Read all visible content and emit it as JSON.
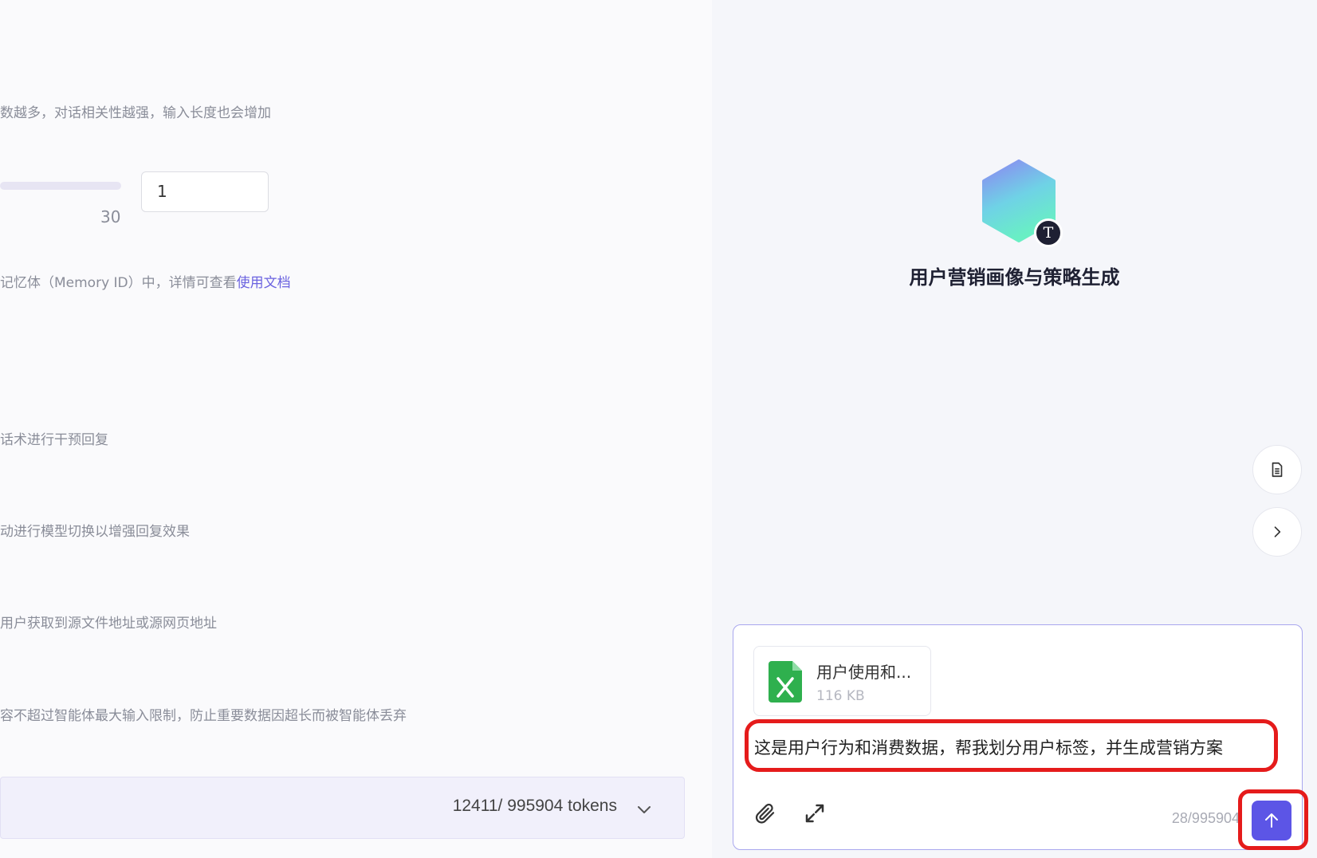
{
  "settings": {
    "rounds_desc": "数越多，对话相关性越强，输入长度也会增加",
    "slider_max": "30",
    "rounds_value": "1",
    "memory_desc_prefix": "记忆体（Memory ID）中，详情可查看",
    "memory_link": "使用文档",
    "intervene_desc": "话术进行干预回复",
    "model_switch_desc": "动进行模型切换以增强回复效果",
    "source_desc": "用户获取到源文件地址或源网页地址",
    "limit_desc": "容不超过智能体最大输入限制，防止重要数据因超长而被智能体丢弃",
    "token_usage": "12411/ 995904 tokens"
  },
  "preview": {
    "agent_badge": "T",
    "agent_title": "用户营销画像与策略生成"
  },
  "composer": {
    "file_name": "用户使用和...",
    "file_size": "116 KB",
    "message": "这是用户行为和消费数据，帮我划分用户标签，并生成营销方案",
    "counter": "28/995904"
  },
  "colors": {
    "accent": "#5c55e6",
    "highlight": "#e51b1b",
    "link": "#6b63e0",
    "excel": "#2fb04e"
  },
  "icons": [
    "chevron-down-icon",
    "document-icon",
    "chevron-right-icon",
    "excel-file-icon",
    "paperclip-icon",
    "expand-icon",
    "arrow-up-icon"
  ]
}
